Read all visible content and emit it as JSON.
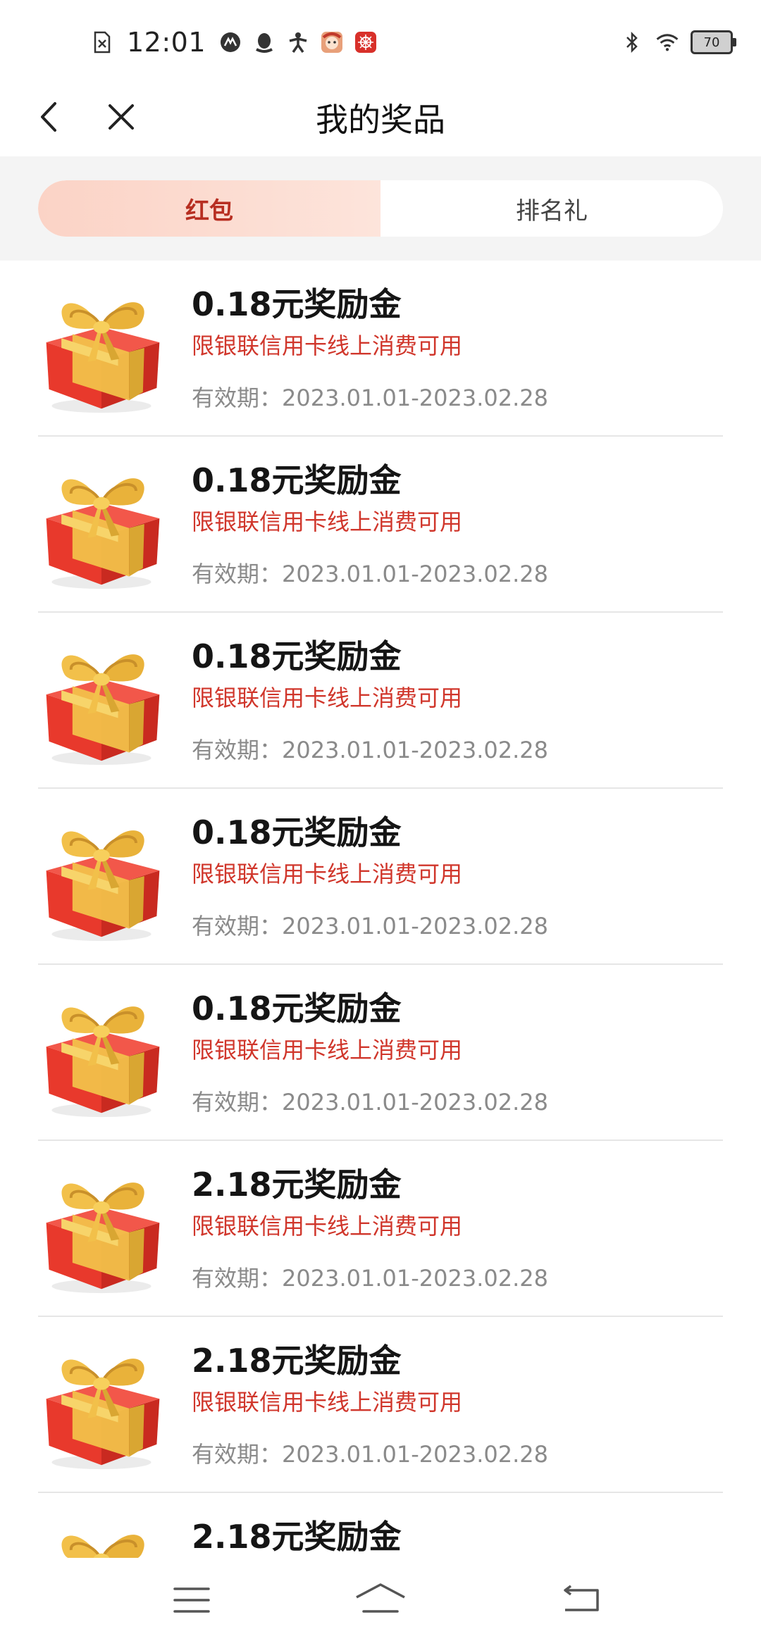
{
  "status_bar": {
    "time": "12:01",
    "battery": "70",
    "icons": [
      "sim-missing-icon",
      "app-icon",
      "qq-icon",
      "activity-icon",
      "cartoon-app-icon",
      "red-app-icon",
      "bluetooth-icon",
      "wifi-icon",
      "battery-icon"
    ]
  },
  "nav": {
    "title": "我的奖品",
    "back_icon": "back-arrow-icon",
    "close_icon": "close-icon"
  },
  "tabs": [
    {
      "label": "红包",
      "active": true
    },
    {
      "label": "排名礼",
      "active": false
    }
  ],
  "prizes": [
    {
      "title": "0.18元奖励金",
      "condition": "限银联信用卡线上消费可用",
      "validity": "有效期：2023.01.01-2023.02.28"
    },
    {
      "title": "0.18元奖励金",
      "condition": "限银联信用卡线上消费可用",
      "validity": "有效期：2023.01.01-2023.02.28"
    },
    {
      "title": "0.18元奖励金",
      "condition": "限银联信用卡线上消费可用",
      "validity": "有效期：2023.01.01-2023.02.28"
    },
    {
      "title": "0.18元奖励金",
      "condition": "限银联信用卡线上消费可用",
      "validity": "有效期：2023.01.01-2023.02.28"
    },
    {
      "title": "0.18元奖励金",
      "condition": "限银联信用卡线上消费可用",
      "validity": "有效期：2023.01.01-2023.02.28"
    },
    {
      "title": "2.18元奖励金",
      "condition": "限银联信用卡线上消费可用",
      "validity": "有效期：2023.01.01-2023.02.28"
    },
    {
      "title": "2.18元奖励金",
      "condition": "限银联信用卡线上消费可用",
      "validity": "有效期：2023.01.01-2023.02.28"
    },
    {
      "title": "2.18元奖励金",
      "condition": "",
      "validity": ""
    }
  ],
  "colors": {
    "accent_red": "#d0362b",
    "tab_active_text": "#b72e21",
    "tab_active_bg": "#fbd3c6",
    "gift_red": "#e8392c",
    "gift_gold": "#f2c04a"
  },
  "bottom_nav": [
    "menu-icon",
    "home-icon",
    "back-icon"
  ]
}
